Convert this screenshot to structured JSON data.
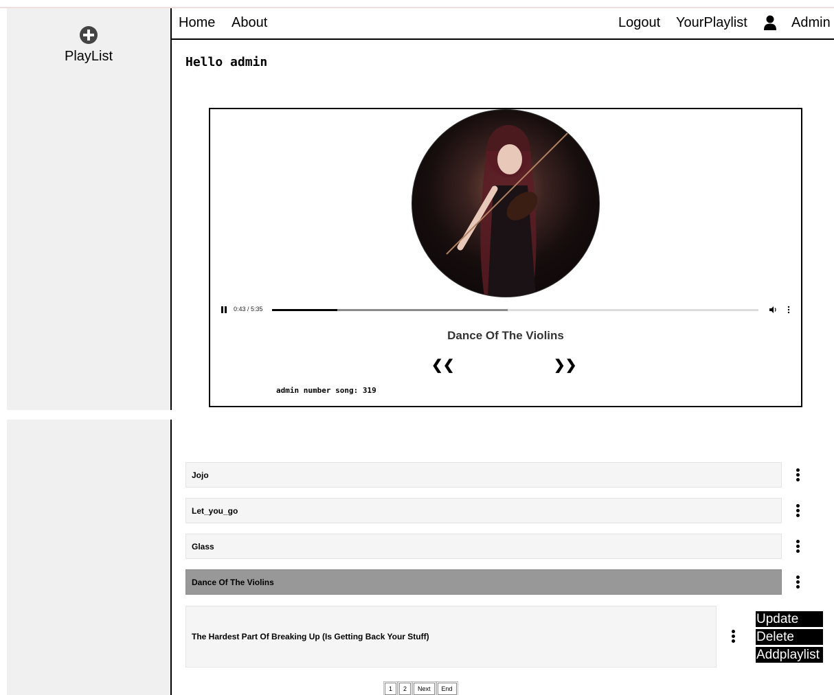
{
  "sidebar": {
    "playlist_label": "PlayList"
  },
  "nav": {
    "home": "Home",
    "about": "About",
    "logout": "Logout",
    "your_playlist": "YourPlaylist",
    "admin": "Admin"
  },
  "greeting": "Hello admin",
  "player": {
    "time": "0:43 / 5:35",
    "progress": 0.134,
    "song_title": "Dance Of The Violins",
    "prev_label": "❮❮",
    "next_label": "❯❯",
    "song_count_text": "admin number song: 319"
  },
  "songs": [
    {
      "title": "Jojo"
    },
    {
      "title": "Let_you_go"
    },
    {
      "title": "Glass"
    },
    {
      "title": "Dance Of The Violins",
      "active": true
    },
    {
      "title": "The Hardest Part Of Breaking Up (Is Getting Back Your Stuff)"
    }
  ],
  "context_menu": {
    "update": "Update",
    "delete": "Delete",
    "add_playlist": "Addplaylist"
  },
  "pagination": {
    "p1": "1",
    "p2": "2",
    "next": "Next",
    "end": "End"
  },
  "colors": {
    "active_row": "#989898",
    "row": "#f5f5f5",
    "sidebar": "#f0f0f0"
  }
}
